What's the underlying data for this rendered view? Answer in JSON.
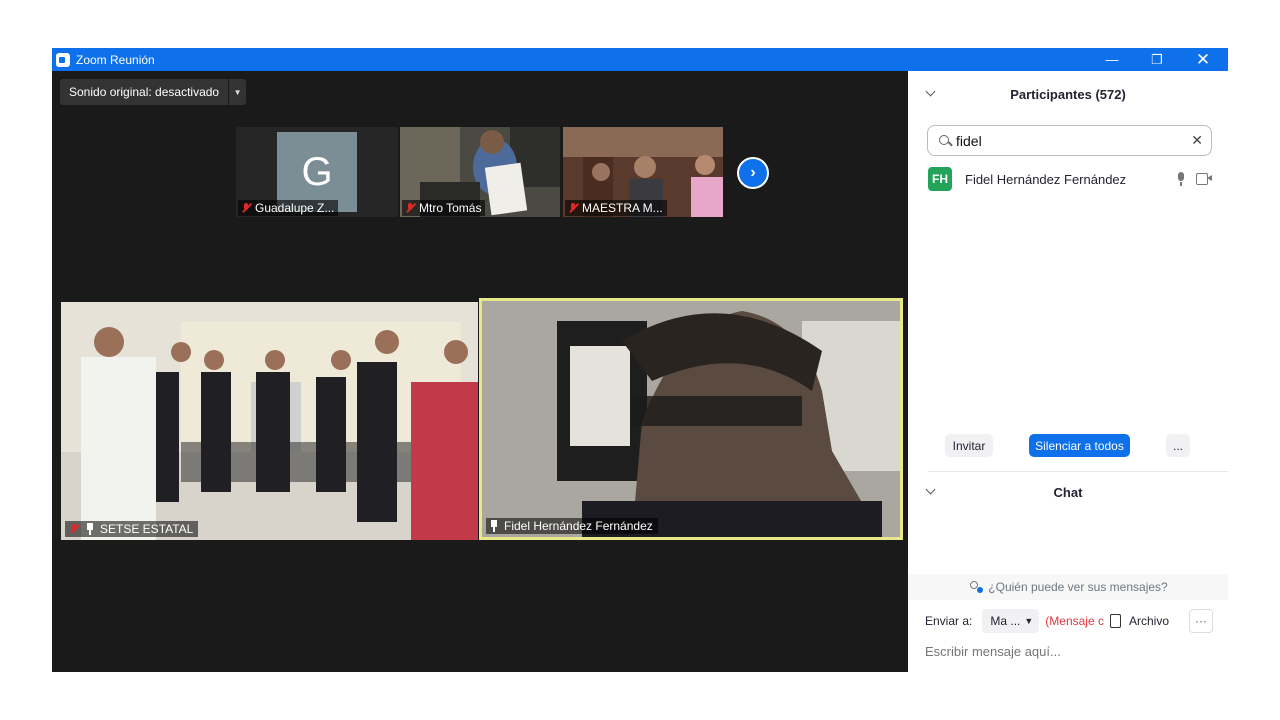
{
  "window": {
    "title": "Zoom Reunión"
  },
  "toolbar": {
    "audio_label": "Sonido original: desactivado"
  },
  "thumbnails": [
    {
      "name": "Guadalupe Z...",
      "initial": "G",
      "muted": true
    },
    {
      "name": "Mtro Tomás",
      "muted": true
    },
    {
      "name": "MAESTRA M...",
      "muted": true
    }
  ],
  "main_videos": [
    {
      "name": "SETSE ESTATAL",
      "muted": true,
      "pinned": true
    },
    {
      "name": "Fidel Hernández Fernández",
      "pinned": true,
      "active_speaker": true
    }
  ],
  "participants": {
    "header": "Participantes (572)",
    "search_value": "fidel",
    "list": [
      {
        "initials": "FH",
        "name": "Fidel Hernández Fernández"
      }
    ],
    "buttons": {
      "invite": "Invitar",
      "mute_all": "Silenciar a todos",
      "more": "..."
    }
  },
  "chat": {
    "header": "Chat",
    "who_can_see": "¿Quién puede ver sus mensajes?",
    "send_to_label": "Enviar a:",
    "send_to_value": "Ma ...",
    "private_label": "(Mensaje c",
    "file_label": "Archivo",
    "more": "···",
    "placeholder": "Escribir mensaje aquí..."
  },
  "colors": {
    "accent": "#0e71eb",
    "speaker_border": "#e8e88a",
    "avatar_bg": "#23a35a",
    "muted_red": "#e02828"
  }
}
